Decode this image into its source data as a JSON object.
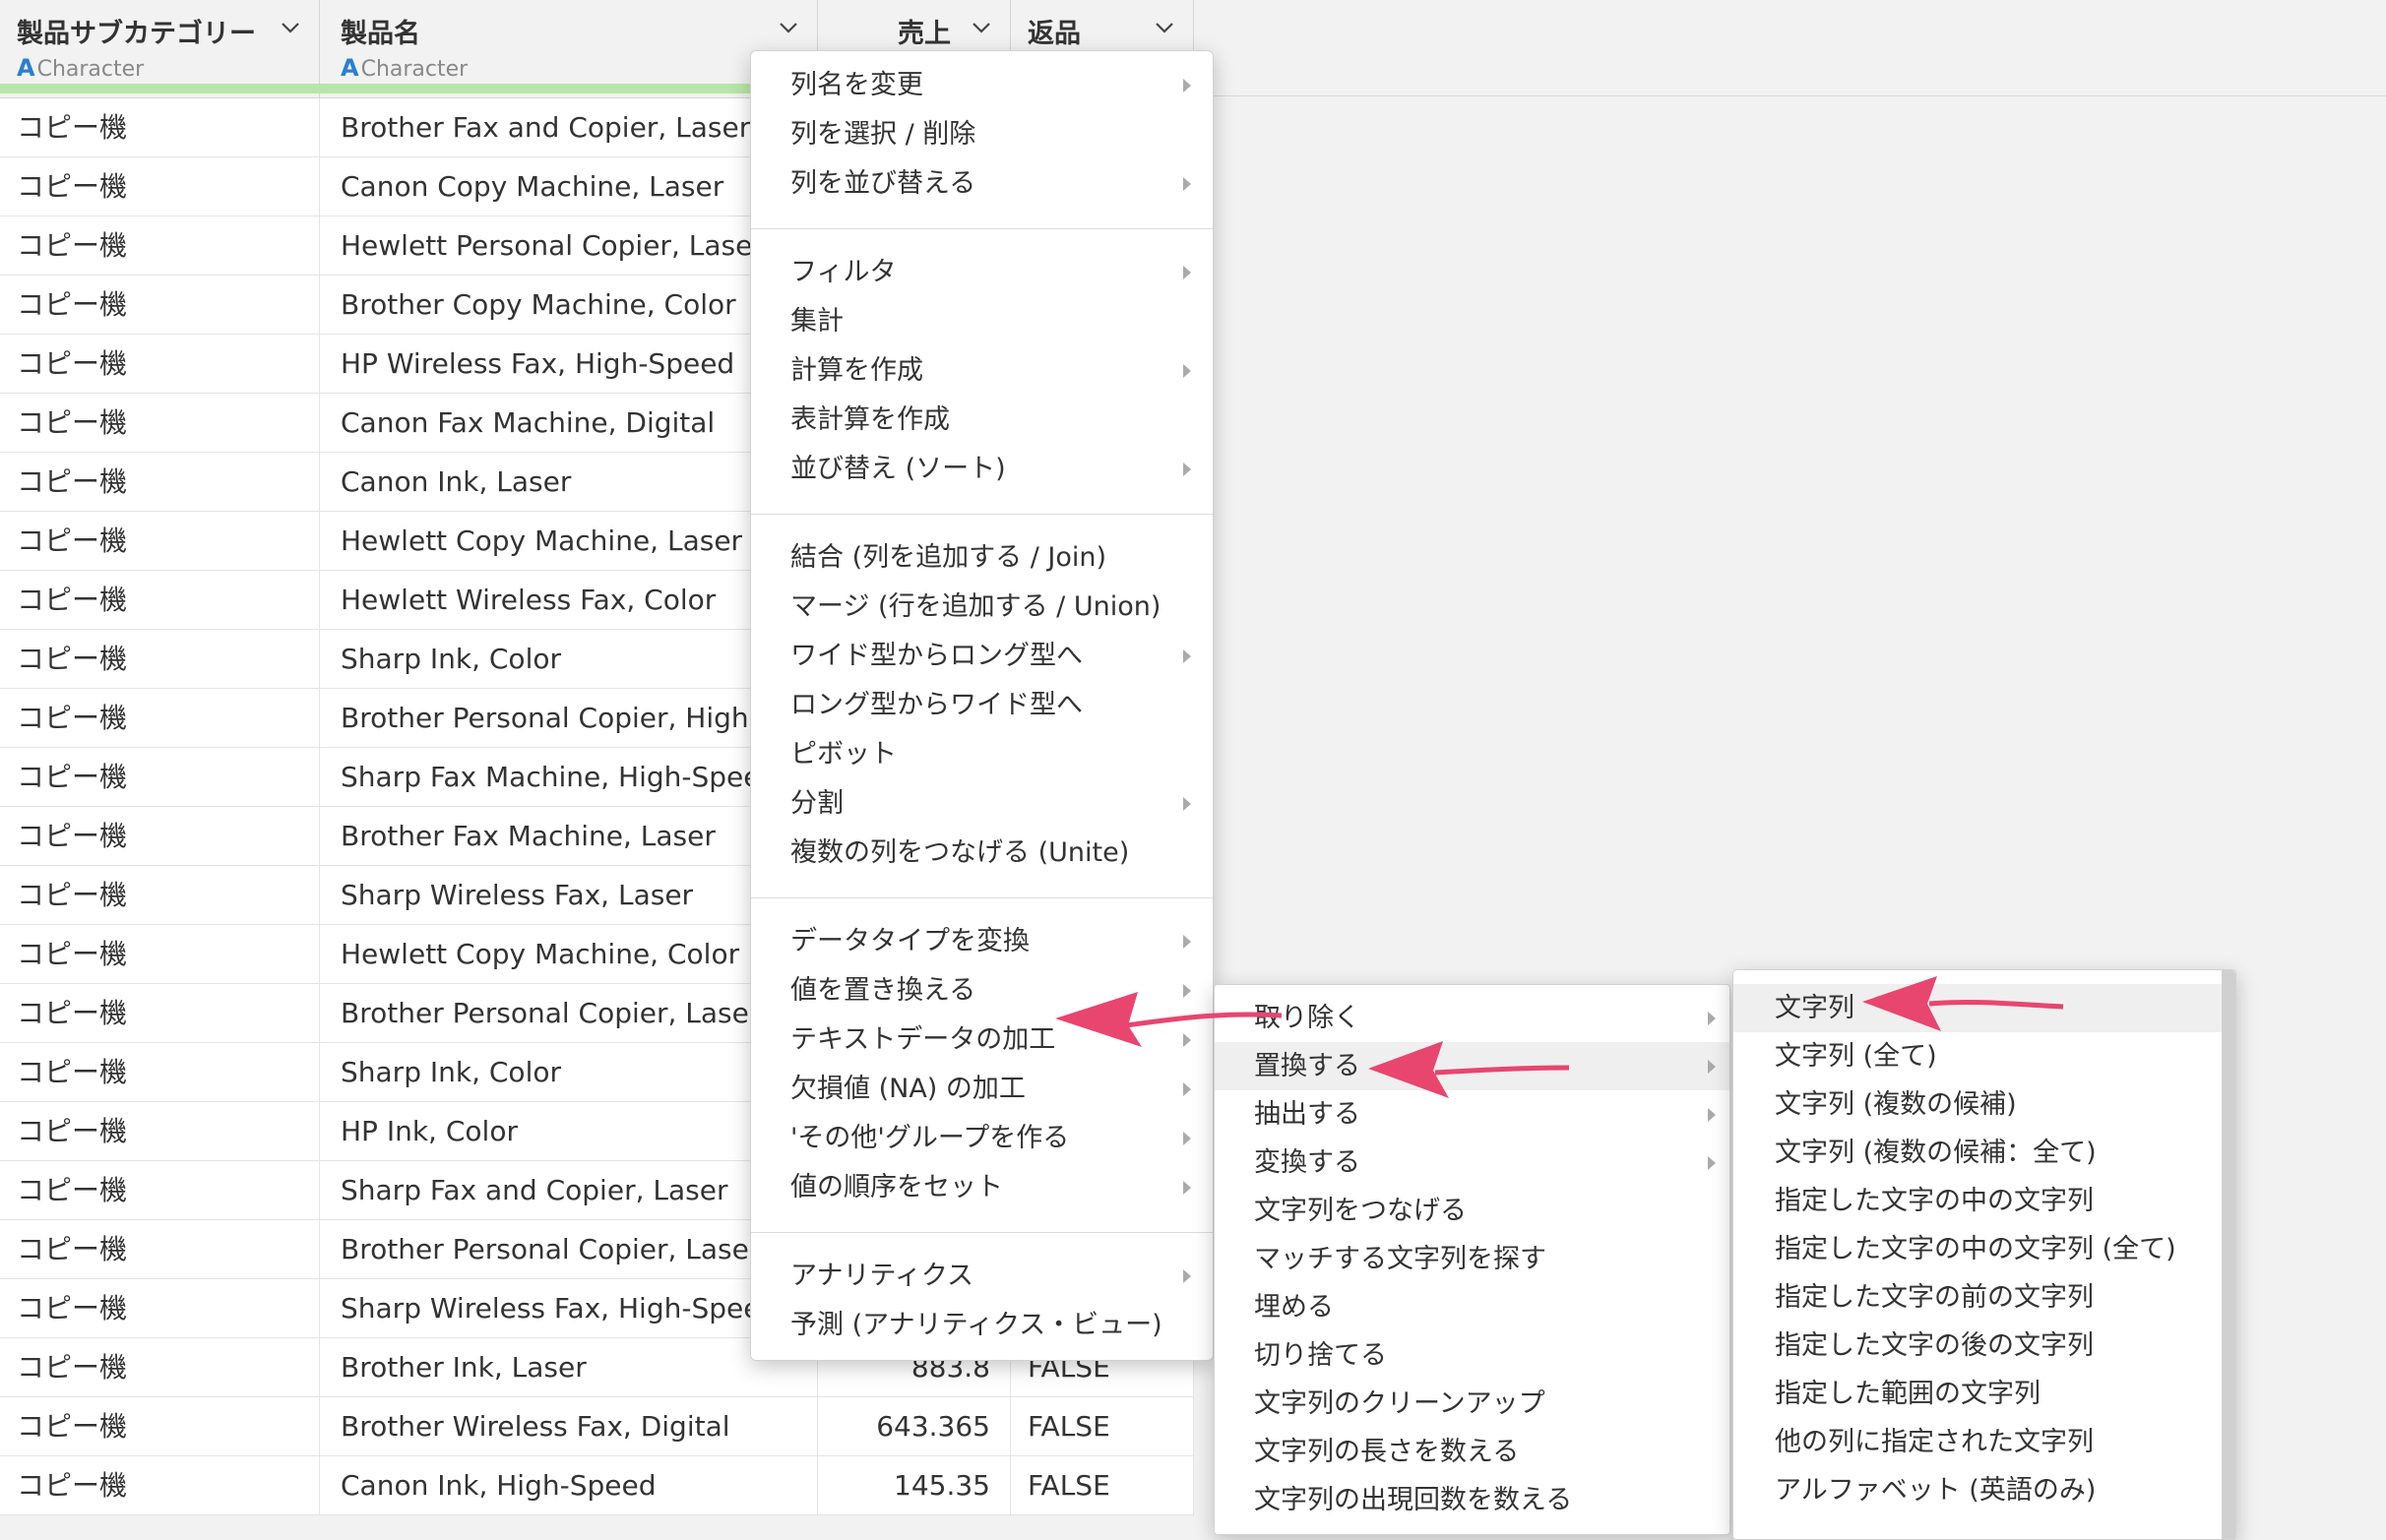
{
  "columns": [
    {
      "name": "製品サブカテゴリー",
      "type": "Character",
      "type_icon": "A"
    },
    {
      "name": "製品名",
      "type": "Character",
      "type_icon": "A"
    },
    {
      "name": "売上",
      "type": ""
    },
    {
      "name": "返品",
      "type": ""
    }
  ],
  "rows": [
    {
      "sub": "コピー機",
      "name": "Brother Fax and Copier, Laser",
      "sales": "",
      "returns": ""
    },
    {
      "sub": "コピー機",
      "name": "Canon Copy Machine, Laser",
      "sales": "",
      "returns": ""
    },
    {
      "sub": "コピー機",
      "name": "Hewlett Personal Copier, Laser",
      "sales": "",
      "returns": ""
    },
    {
      "sub": "コピー機",
      "name": "Brother Copy Machine, Color",
      "sales": "",
      "returns": ""
    },
    {
      "sub": "コピー機",
      "name": "HP Wireless Fax, High-Speed",
      "sales": "",
      "returns": ""
    },
    {
      "sub": "コピー機",
      "name": "Canon Fax Machine, Digital",
      "sales": "",
      "returns": ""
    },
    {
      "sub": "コピー機",
      "name": "Canon Ink, Laser",
      "sales": "",
      "returns": ""
    },
    {
      "sub": "コピー機",
      "name": "Hewlett Copy Machine, Laser",
      "sales": "",
      "returns": ""
    },
    {
      "sub": "コピー機",
      "name": "Hewlett Wireless Fax, Color",
      "sales": "",
      "returns": ""
    },
    {
      "sub": "コピー機",
      "name": "Sharp Ink, Color",
      "sales": "",
      "returns": ""
    },
    {
      "sub": "コピー機",
      "name": "Brother Personal Copier, High-Sp",
      "sales": "",
      "returns": ""
    },
    {
      "sub": "コピー機",
      "name": "Sharp Fax Machine, High-Speed",
      "sales": "",
      "returns": ""
    },
    {
      "sub": "コピー機",
      "name": "Brother Fax Machine, Laser",
      "sales": "",
      "returns": ""
    },
    {
      "sub": "コピー機",
      "name": "Sharp Wireless Fax, Laser",
      "sales": "",
      "returns": ""
    },
    {
      "sub": "コピー機",
      "name": "Hewlett Copy Machine, Color",
      "sales": "",
      "returns": ""
    },
    {
      "sub": "コピー機",
      "name": "Brother Personal Copier, Laser",
      "sales": "",
      "returns": ""
    },
    {
      "sub": "コピー機",
      "name": "Sharp Ink, Color",
      "sales": "",
      "returns": ""
    },
    {
      "sub": "コピー機",
      "name": "HP Ink, Color",
      "sales": "",
      "returns": ""
    },
    {
      "sub": "コピー機",
      "name": "Sharp Fax and Copier, Laser",
      "sales": "",
      "returns": ""
    },
    {
      "sub": "コピー機",
      "name": "Brother Personal Copier, Laser",
      "sales": "",
      "returns": ""
    },
    {
      "sub": "コピー機",
      "name": "Sharp Wireless Fax, High-Speed",
      "sales": "",
      "returns": ""
    },
    {
      "sub": "コピー機",
      "name": "Brother Ink, Laser",
      "sales": "883.8",
      "returns": "FALSE"
    },
    {
      "sub": "コピー機",
      "name": "Brother Wireless Fax, Digital",
      "sales": "643.365",
      "returns": "FALSE"
    },
    {
      "sub": "コピー機",
      "name": "Canon Ink, High-Speed",
      "sales": "145.35",
      "returns": "FALSE"
    }
  ],
  "menu1": {
    "groups": [
      [
        {
          "label": "列名を変更",
          "sub": true
        },
        {
          "label": "列を選択 / 削除",
          "sub": false
        },
        {
          "label": "列を並び替える",
          "sub": true
        }
      ],
      [
        {
          "label": "フィルタ",
          "sub": true
        },
        {
          "label": "集計",
          "sub": false
        },
        {
          "label": "計算を作成",
          "sub": true
        },
        {
          "label": "表計算を作成",
          "sub": false
        },
        {
          "label": "並び替え (ソート)",
          "sub": true
        }
      ],
      [
        {
          "label": "結合 (列を追加する / Join)",
          "sub": false
        },
        {
          "label": "マージ (行を追加する / Union)",
          "sub": false
        },
        {
          "label": "ワイド型からロング型へ",
          "sub": true
        },
        {
          "label": "ロング型からワイド型へ",
          "sub": false
        },
        {
          "label": "ピボット",
          "sub": false
        },
        {
          "label": "分割",
          "sub": true
        },
        {
          "label": "複数の列をつなげる (Unite)",
          "sub": false
        }
      ],
      [
        {
          "label": "データタイプを変換",
          "sub": true
        },
        {
          "label": "値を置き換える",
          "sub": true
        },
        {
          "label": "テキストデータの加工",
          "sub": true
        },
        {
          "label": "欠損値 (NA) の加工",
          "sub": true
        },
        {
          "label": "'その他'グループを作る",
          "sub": true
        },
        {
          "label": "値の順序をセット",
          "sub": true
        }
      ],
      [
        {
          "label": "アナリティクス",
          "sub": true
        },
        {
          "label": "予測 (アナリティクス・ビュー)",
          "sub": false
        }
      ]
    ]
  },
  "menu2": {
    "items": [
      {
        "label": "取り除く",
        "sub": true
      },
      {
        "label": "置換する",
        "sub": true
      },
      {
        "label": "抽出する",
        "sub": true
      },
      {
        "label": "変換する",
        "sub": true
      },
      {
        "label": "文字列をつなげる",
        "sub": false
      },
      {
        "label": "マッチする文字列を探す",
        "sub": false
      },
      {
        "label": "埋める",
        "sub": false
      },
      {
        "label": "切り捨てる",
        "sub": false
      },
      {
        "label": "文字列のクリーンアップ",
        "sub": false
      },
      {
        "label": "文字列の長さを数える",
        "sub": false
      },
      {
        "label": "文字列の出現回数を数える",
        "sub": false
      }
    ]
  },
  "menu3": {
    "items": [
      "文字列",
      "文字列 (全て)",
      "文字列 (複数の候補)",
      "文字列 (複数の候補：全て)",
      "指定した文字の中の文字列",
      "指定した文字の中の文字列 (全て)",
      "指定した文字の前の文字列",
      "指定した文字の後の文字列",
      "指定した範囲の文字列",
      "他の列に指定された文字列",
      "アルファベット (英語のみ)"
    ]
  },
  "colors": {
    "accent_arrow": "#e8456f",
    "type_icon": "#2a7fd4",
    "progress_green": "#b8e6a8"
  }
}
